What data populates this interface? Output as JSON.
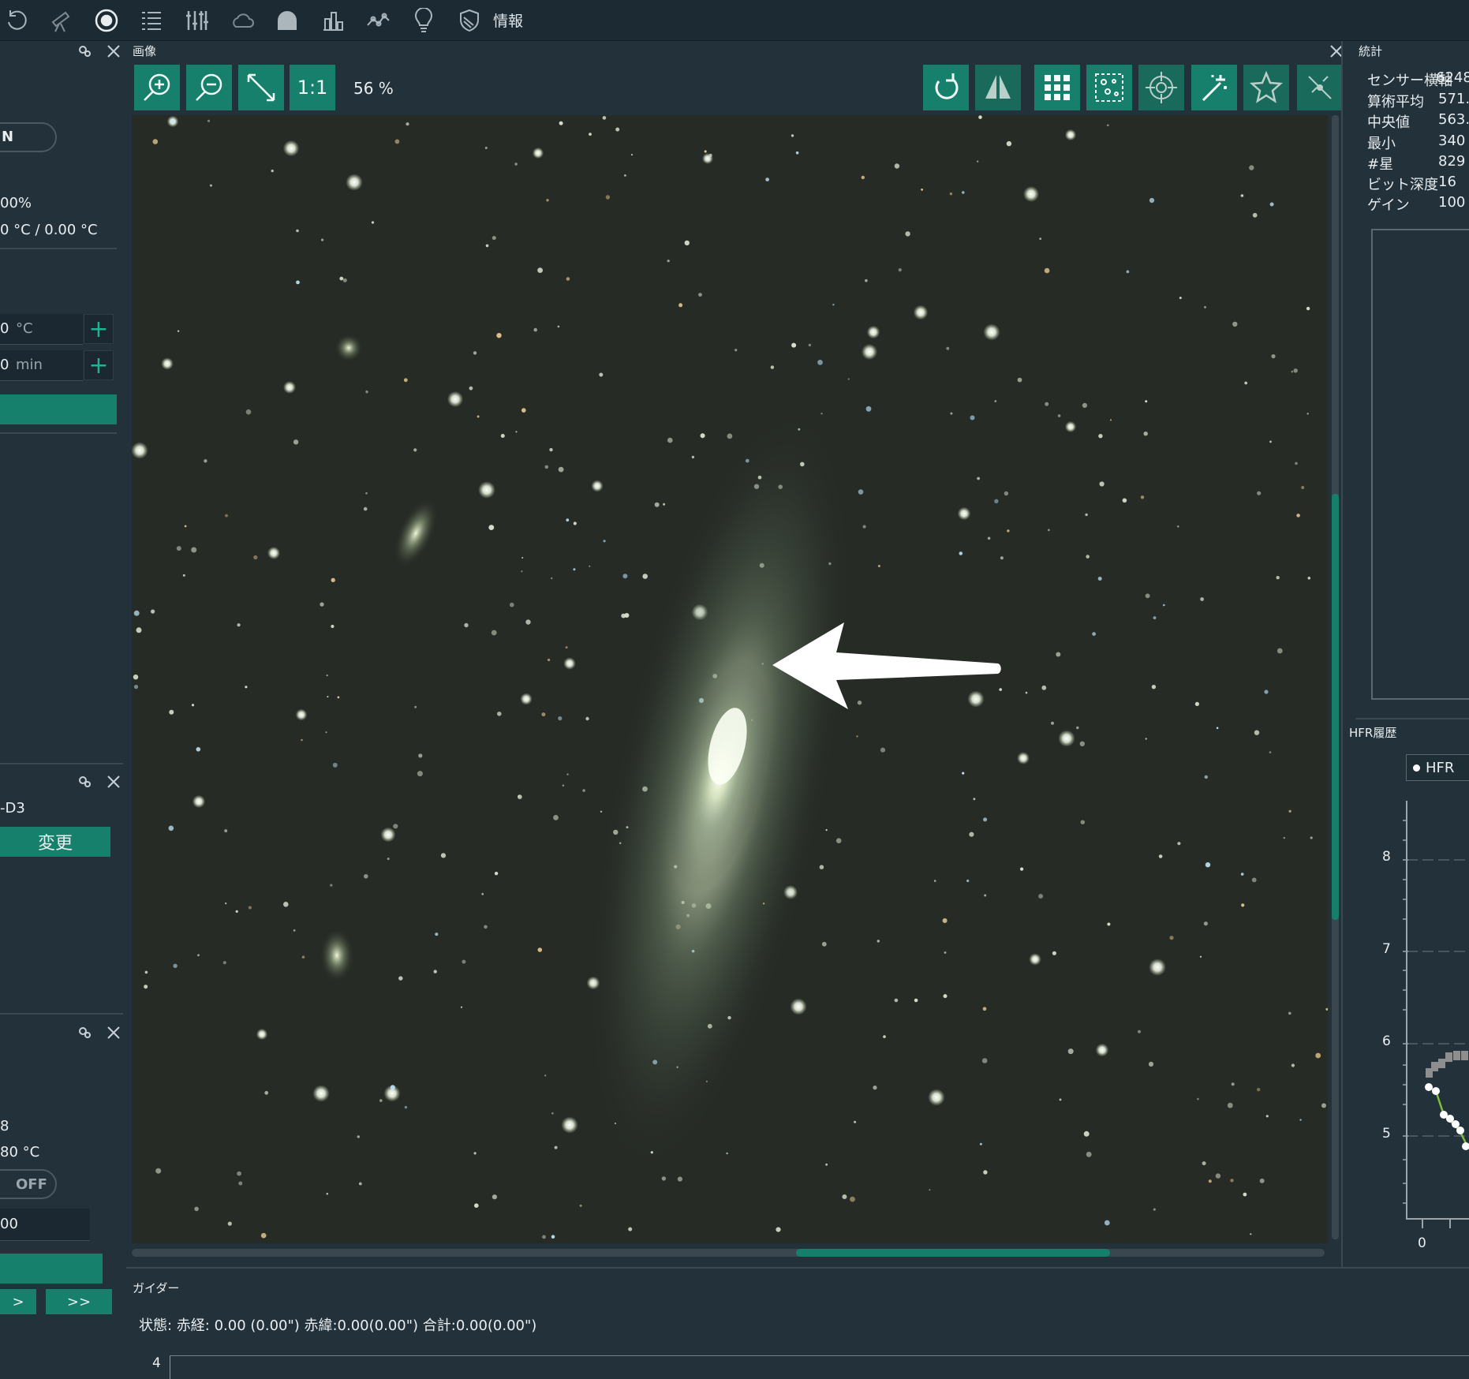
{
  "topbar": {
    "icons": [
      "refresh-icon",
      "telescope-icon",
      "target-icon",
      "sequence-list-icon",
      "sliders-icon",
      "cloud-icon",
      "observatory-icon",
      "bar-chart-icon",
      "line-chart-icon",
      "lightbulb-icon",
      "shield-icon"
    ],
    "info_label": "情報"
  },
  "left_panel": {
    "toggle_text": "N",
    "percent": "00%",
    "temps": "0 °C / 0.00 °C",
    "temp_input": {
      "value": "0",
      "unit": "°C"
    },
    "time_input": {
      "value": "0",
      "unit": "min"
    },
    "device_text": "-D3",
    "change_button": "変更",
    "value_8": "8",
    "temp2": "80 °C",
    "off_toggle": "OFF",
    "field_value": "00",
    "prev_button": ">",
    "next_button": ">>"
  },
  "image_panel": {
    "title": "画像",
    "zoom_1to1": "1:1",
    "zoom_percent": "56 %"
  },
  "stats_panel": {
    "title": "統計",
    "rows": [
      {
        "key": "センサー横軸",
        "value": "6248"
      },
      {
        "key": "算術平均",
        "value": "571."
      },
      {
        "key": "中央値",
        "value": "563."
      },
      {
        "key": "最小",
        "value": "340"
      },
      {
        "key": "#星",
        "value": "829"
      },
      {
        "key": "ビット深度",
        "value": "16"
      },
      {
        "key": "ゲイン",
        "value": "100"
      }
    ]
  },
  "hfr_panel": {
    "title": "HFR履歴",
    "legend": "HFR",
    "y_ticks": [
      "8",
      "7",
      "6",
      "5"
    ],
    "x_ticks": [
      "0"
    ]
  },
  "guider_panel": {
    "title": "ガイダー",
    "status": "状態:  赤経: 0.00 (0.00\")  赤緯:0.00(0.00\")  合計:0.00(0.00\")",
    "y_tick": "4"
  },
  "colors": {
    "accent": "#17806c",
    "panel_bg": "#22313a",
    "topbar_bg": "#1b2a33"
  }
}
